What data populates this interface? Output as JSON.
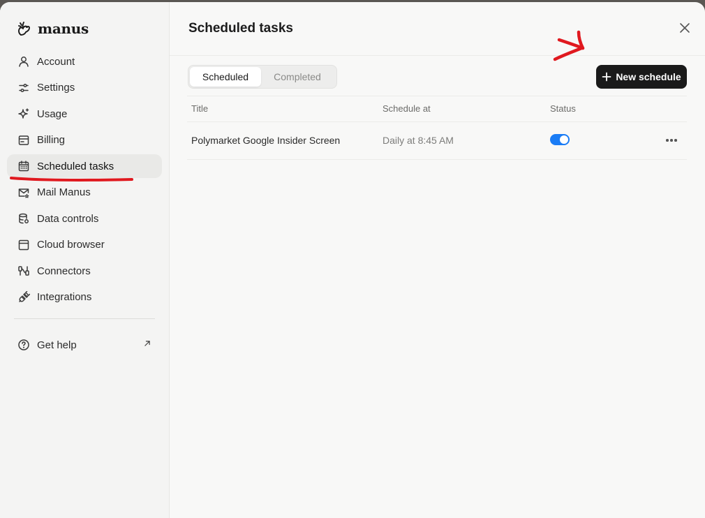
{
  "brand": {
    "name": "manus"
  },
  "sidebar": {
    "items": [
      {
        "label": "Account",
        "icon": "user-icon"
      },
      {
        "label": "Settings",
        "icon": "sliders-icon"
      },
      {
        "label": "Usage",
        "icon": "sparkle-icon"
      },
      {
        "label": "Billing",
        "icon": "billing-icon"
      },
      {
        "label": "Scheduled tasks",
        "icon": "calendar-icon",
        "active": true
      },
      {
        "label": "Mail Manus",
        "icon": "mail-icon"
      },
      {
        "label": "Data controls",
        "icon": "database-icon"
      },
      {
        "label": "Cloud browser",
        "icon": "browser-icon"
      },
      {
        "label": "Connectors",
        "icon": "connectors-icon"
      },
      {
        "label": "Integrations",
        "icon": "plug-icon"
      }
    ],
    "help": {
      "label": "Get help",
      "icon": "help-icon",
      "external_icon": "arrow-up-right-icon"
    }
  },
  "main": {
    "title": "Scheduled tasks",
    "tabs": [
      {
        "label": "Scheduled",
        "active": true
      },
      {
        "label": "Completed",
        "active": false
      }
    ],
    "new_button": {
      "label": "New schedule",
      "icon": "plus-icon"
    },
    "table": {
      "columns": [
        "Title",
        "Schedule at",
        "Status"
      ],
      "rows": [
        {
          "title": "Polymarket Google Insider Screen",
          "schedule": "Daily at 8:45 AM",
          "status": "on"
        }
      ]
    }
  },
  "colors": {
    "accent": "#1a7cf5",
    "button_dark": "#1a1a1a",
    "annotation_red": "#e0191f"
  }
}
